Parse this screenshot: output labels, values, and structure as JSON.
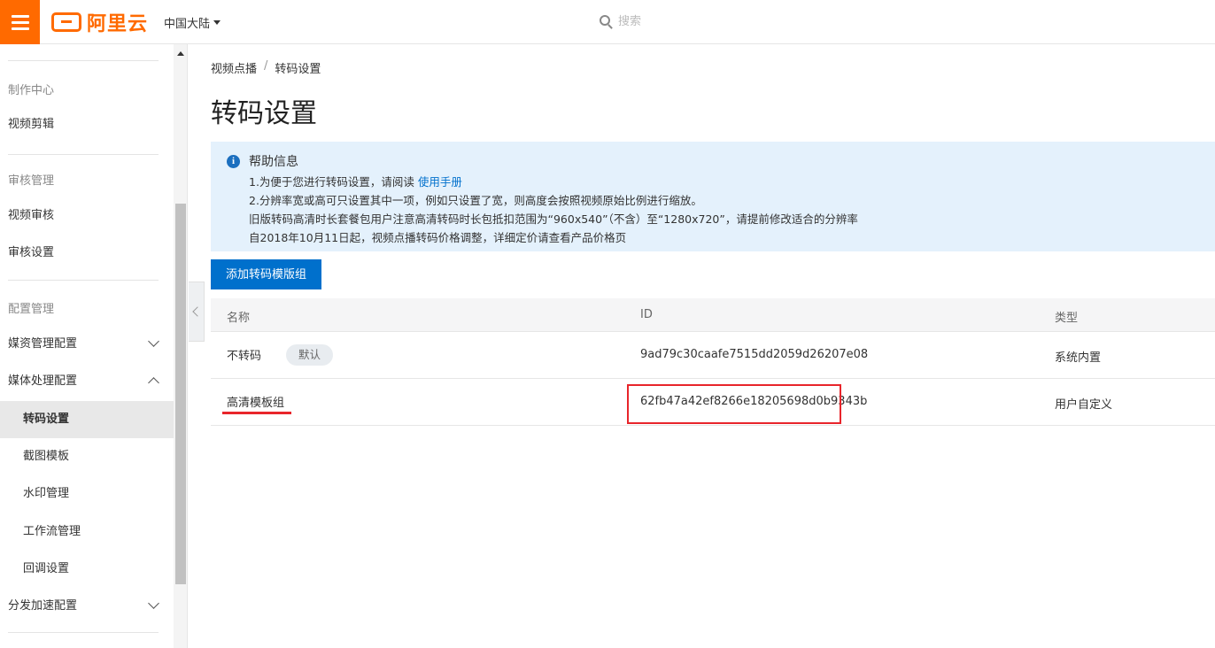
{
  "topbar": {
    "logo_text": "阿里云",
    "region": "中国大陆",
    "search_placeholder": "搜索"
  },
  "sidebar": {
    "groups": [
      {
        "label": "制作中心"
      },
      {
        "label": "审核管理"
      },
      {
        "label": "配置管理"
      }
    ],
    "items": {
      "video_edit": "视频剪辑",
      "video_review": "视频审核",
      "review_settings": "审核设置",
      "media_asset_config": "媒资管理配置",
      "media_process_config": "媒体处理配置",
      "transcode_settings": "转码设置",
      "snapshot_template": "截图模板",
      "watermark_management": "水印管理",
      "workflow_management": "工作流管理",
      "callback_settings": "回调设置",
      "distribution_acceleration": "分发加速配置"
    }
  },
  "breadcrumb": {
    "root": "视频点播",
    "separator": "/",
    "current": "转码设置"
  },
  "page_title": "转码设置",
  "help": {
    "icon": "info-icon",
    "title": "帮助信息",
    "line1_prefix": "1.为便于您进行转码设置，请阅读 ",
    "line1_link": "使用手册",
    "line2": "2.分辨率宽或高可只设置其中一项，例如只设置了宽，则高度会按照视频原始比例进行缩放。",
    "line3": "旧版转码高清时长套餐包用户注意高清转码时长包抵扣范围为“960x540”（不含）至“1280x720”，请提前修改适合的分辨率",
    "line4": "自2018年10月11日起，视频点播转码价格调整，详细定价请查看产品价格页"
  },
  "add_button": "添加转码模版组",
  "table": {
    "headers": {
      "name": "名称",
      "id": "ID",
      "type": "类型"
    },
    "rows": [
      {
        "name": "不转码",
        "badge": "默认",
        "id": "9ad79c30caafe7515dd2059d26207e08",
        "type": "系统内置"
      },
      {
        "name": "高清模板组",
        "id": "62fb47a42ef8266e18205698d0b9343b",
        "type": "用户自定义"
      }
    ]
  },
  "colors": {
    "brand": "#ff6a00",
    "primary": "#0070cc",
    "highlight_red": "#e8252b",
    "help_bg": "#e4f1fc"
  }
}
